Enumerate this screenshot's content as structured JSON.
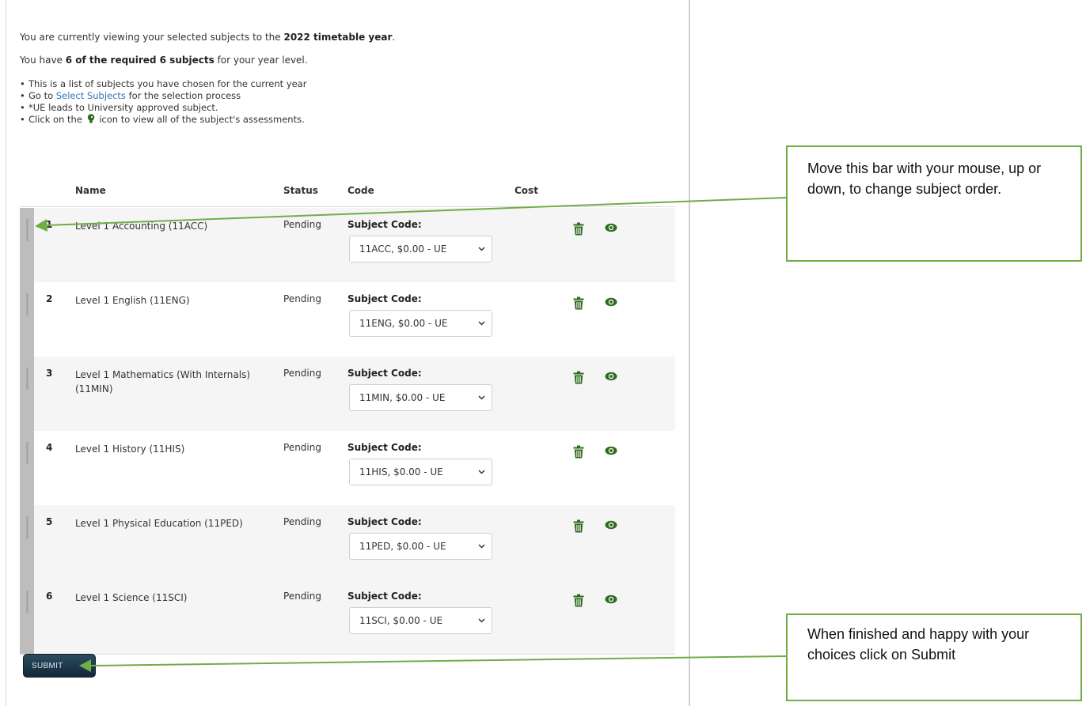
{
  "intro": {
    "line1_prefix": "You are currently viewing your selected subjects to the ",
    "line1_bold": "2022 timetable year",
    "line1_suffix": ".",
    "line2_prefix": "You have ",
    "line2_bold": "6 of the required 6 subjects",
    "line2_suffix": " for your year level."
  },
  "bullets": {
    "b1": "This is a list of subjects you have chosen for the current year",
    "b2_prefix": "Go to ",
    "b2_link": "Select Subjects",
    "b2_suffix": " for the selection process",
    "b3": "*UE leads to University approved subject.",
    "b4_prefix": "Click on the ",
    "b4_suffix": " icon to view all of the subject's assessments."
  },
  "table": {
    "headers": {
      "name": "Name",
      "status": "Status",
      "code": "Code",
      "cost": "Cost"
    },
    "code_label": "Subject Code:",
    "rows": [
      {
        "num": "1",
        "name": "Level 1 Accounting (11ACC)",
        "status": "Pending",
        "code_value": "11ACC, $0.00 - UE"
      },
      {
        "num": "2",
        "name": "Level 1 English (11ENG)",
        "status": "Pending",
        "code_value": "11ENG, $0.00 - UE"
      },
      {
        "num": "3",
        "name": "Level 1 Mathematics (With Internals) (11MIN)",
        "status": "Pending",
        "code_value": "11MIN, $0.00 - UE"
      },
      {
        "num": "4",
        "name": "Level 1 History (11HIS)",
        "status": "Pending",
        "code_value": "11HIS, $0.00 - UE"
      },
      {
        "num": "5",
        "name": "Level 1 Physical Education (11PED)",
        "status": "Pending",
        "code_value": "11PED, $0.00 - UE"
      },
      {
        "num": "6",
        "name": "Level 1 Science (11SCI)",
        "status": "Pending",
        "code_value": "11SCI, $0.00 - UE"
      }
    ]
  },
  "submit_label": "SUBMIT",
  "callouts": {
    "reorder": "Move this bar with your mouse, up or down, to change subject order.",
    "submit": "When finished and happy with your choices click on Submit"
  },
  "colors": {
    "icon_green": "#2f6b1e",
    "callout_border": "#70ad47",
    "link_blue": "#2f73b7",
    "submit_bg": "#1e3648"
  },
  "icons": {
    "delete": "trash-icon",
    "view": "eye-icon",
    "assessment": "head-icon"
  }
}
